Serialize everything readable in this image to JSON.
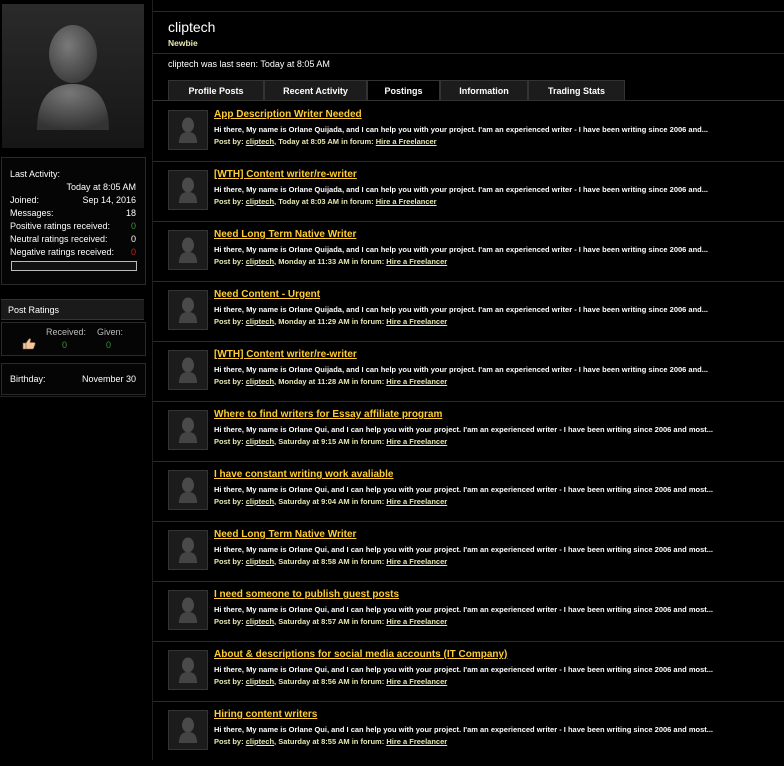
{
  "profile": {
    "username": "cliptech",
    "user_title": "Newbie",
    "last_seen": "cliptech was last seen: Today at 8:05 AM"
  },
  "stats": {
    "last_activity_label": "Last Activity:",
    "last_activity_value": "Today at 8:05 AM",
    "joined_label": "Joined:",
    "joined_value": "Sep 14, 2016",
    "messages_label": "Messages:",
    "messages_value": "18",
    "positive_label": "Positive ratings received:",
    "positive_value": "0",
    "neutral_label": "Neutral ratings received:",
    "neutral_value": "0",
    "negative_label": "Negative ratings received:",
    "negative_value": "0"
  },
  "post_ratings": {
    "heading": "Post Ratings",
    "received_label": "Received:",
    "given_label": "Given:",
    "received_value": "0",
    "given_value": "0"
  },
  "birthday": {
    "label": "Birthday:",
    "value": "November 30"
  },
  "tabs": [
    {
      "label": "Profile Posts"
    },
    {
      "label": "Recent Activity"
    },
    {
      "label": "Postings"
    },
    {
      "label": "Information"
    },
    {
      "label": "Trading Stats"
    }
  ],
  "meta_labels": {
    "post_by": "Post by:",
    "in_forum": "in forum:"
  },
  "posts": [
    {
      "title": "App Description Writer Needed",
      "snippet": "Hi there, My name is Orlane Quijada, and I can help you with your project. I'am an experienced writer - I have been writing since 2006 and...",
      "author": "cliptech",
      "time": ", Today at 8:05 AM",
      "forum": "Hire a Freelancer"
    },
    {
      "title": "[WTH] Content writer/re-writer",
      "snippet": "Hi there, My name is Orlane Quijada, and I can help you with your project. I'am an experienced writer - I have been writing since 2006 and...",
      "author": "cliptech",
      "time": ", Today at 8:03 AM",
      "forum": "Hire a Freelancer"
    },
    {
      "title": "Need Long Term Native Writer",
      "snippet": "Hi there, My name is Orlane Quijada, and I can help you with your project. I'am an experienced writer - I have been writing since 2006 and...",
      "author": "cliptech",
      "time": ", Monday at 11:33 AM",
      "forum": "Hire a Freelancer"
    },
    {
      "title": "Need Content - Urgent",
      "snippet": "Hi there, My name is Orlane Quijada, and I can help you with your project. I'am an experienced writer - I have been writing since 2006 and...",
      "author": "cliptech",
      "time": ", Monday at 11:29 AM",
      "forum": "Hire a Freelancer"
    },
    {
      "title": "[WTH] Content writer/re-writer",
      "snippet": "Hi there, My name is Orlane Quijada, and I can help you with your project. I'am an experienced writer - I have been writing since 2006 and...",
      "author": "cliptech",
      "time": ", Monday at 11:28 AM",
      "forum": "Hire a Freelancer"
    },
    {
      "title": "Where to find writers for Essay affiliate program",
      "snippet": "Hi there, My name is Orlane Qui, and I can help you with your project. I'am an experienced writer - I have been writing since 2006 and most...",
      "author": "cliptech",
      "time": ", Saturday at 9:15 AM",
      "forum": "Hire a Freelancer"
    },
    {
      "title": "I have constant writing work avaliable",
      "snippet": "Hi there, My name is Orlane Qui, and I can help you with your project. I'am an experienced writer - I have been writing since 2006 and most...",
      "author": "cliptech",
      "time": ", Saturday at 9:04 AM",
      "forum": "Hire a Freelancer"
    },
    {
      "title": "Need Long Term Native Writer",
      "snippet": "Hi there, My name is Orlane Qui, and I can help you with your project. I'am an experienced writer - I have been writing since 2006 and most...",
      "author": "cliptech",
      "time": ", Saturday at 8:58 AM",
      "forum": "Hire a Freelancer"
    },
    {
      "title": "I need someone to publish guest posts",
      "snippet": "Hi there, My name is Orlane Qui, and I can help you with your project. I'am an experienced writer - I have been writing since 2006 and most...",
      "author": "cliptech",
      "time": ", Saturday at 8:57 AM",
      "forum": "Hire a Freelancer"
    },
    {
      "title": "About & descriptions for social media accounts (IT Company)",
      "snippet": "Hi there, My name is Orlane Qui, and I can help you with your project. I'am an experienced writer - I have been writing since 2006 and most...",
      "author": "cliptech",
      "time": ", Saturday at 8:56 AM",
      "forum": "Hire a Freelancer"
    },
    {
      "title": "Hiring content writers",
      "snippet": "Hi there, My name is Orlane Qui, and I can help you with your project. I'am an experienced writer - I have been writing since 2006 and most...",
      "author": "cliptech",
      "time": ", Saturday at 8:55 AM",
      "forum": "Hire a Freelancer"
    }
  ],
  "colors": {
    "title_link": "#ffcc33",
    "meta_text": "#e8e8b0",
    "positive": "#2f9c2f",
    "negative": "#c62020"
  }
}
